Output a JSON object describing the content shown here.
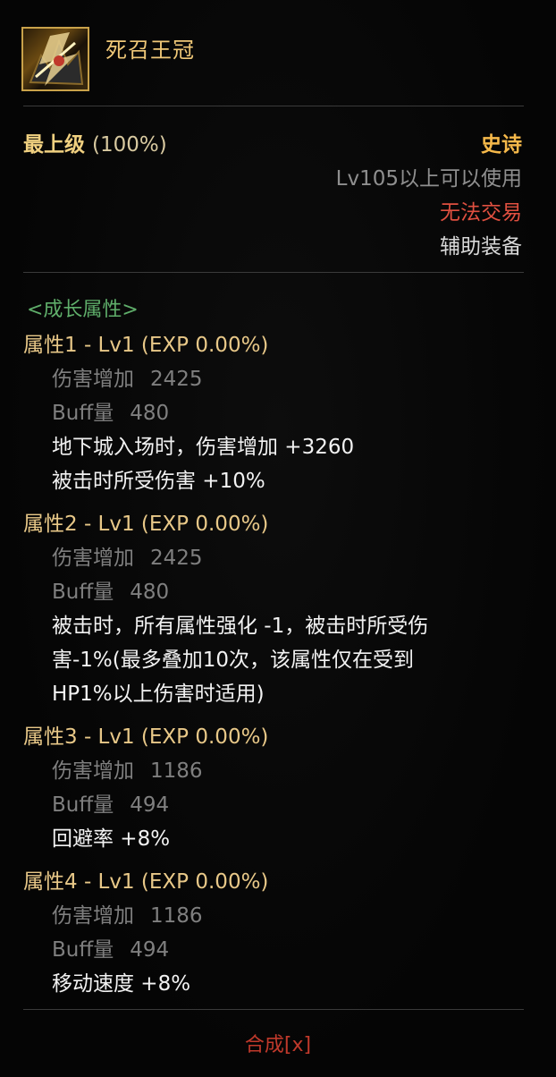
{
  "item": {
    "name": "死召王冠",
    "icon": "crown-of-death-summoner-icon",
    "grade_label": "最上级",
    "grade_pct": "(100%)",
    "rarity": "史诗",
    "level_req": "Lv105以上可以使用",
    "trade": "无法交易",
    "type": "辅助装备"
  },
  "growth": {
    "section_title": "<成长属性>",
    "attrs": [
      {
        "head": "属性1 - Lv1 (EXP 0.00%)",
        "dmg_label": "伤害增加",
        "dmg_val": "2425",
        "buff_label": "Buff量",
        "buff_val": "480",
        "effects": [
          "地下城入场时，伤害增加 +3260",
          "被击时所受伤害 +10%"
        ]
      },
      {
        "head": "属性2 - Lv1 (EXP 0.00%)",
        "dmg_label": "伤害增加",
        "dmg_val": "2425",
        "buff_label": "Buff量",
        "buff_val": "480",
        "effects": [
          "被击时，所有属性强化 -1，被击时所受伤",
          "害-1%(最多叠加10次，该属性仅在受到",
          "HP1%以上伤害时适用)"
        ]
      },
      {
        "head": "属性3 - Lv1 (EXP 0.00%)",
        "dmg_label": "伤害增加",
        "dmg_val": "1186",
        "buff_label": "Buff量",
        "buff_val": "494",
        "effects": [
          "回避率 +8%"
        ]
      },
      {
        "head": "属性4 - Lv1 (EXP 0.00%)",
        "dmg_label": "伤害增加",
        "dmg_val": "1186",
        "buff_label": "Buff量",
        "buff_val": "494",
        "effects": [
          "移动速度 +8%"
        ]
      }
    ]
  },
  "footer": {
    "combine_label": "合成[x]"
  },
  "colors": {
    "name": "#f0c878",
    "rarity": "#f5b84a",
    "untradable": "#e05040",
    "section": "#5fae6a",
    "attr_head": "#e8c888",
    "stat": "#7f7f7f",
    "effect": "#f2f2f2",
    "combine": "#c0392b"
  }
}
